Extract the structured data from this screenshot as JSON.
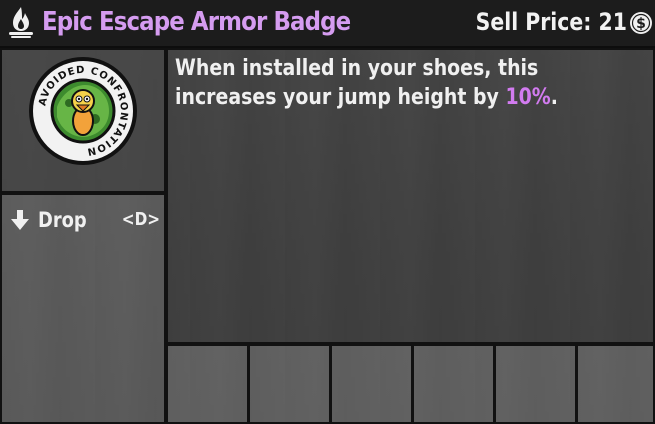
{
  "header": {
    "title": "Epic Escape Armor Badge",
    "sell_label": "Sell Price:",
    "sell_value": "21",
    "flame_icon": "campfire-icon",
    "coin_icon": "dukes-coin-icon",
    "title_color": "#d59cf0"
  },
  "item": {
    "icon": "avoided-confrontation-badge",
    "badge_text": "AVOIDED CONFRONTATION"
  },
  "description": {
    "text_before": "When installed in your shoes, this increases your jump height by ",
    "highlight": "10%",
    "text_after": ".",
    "highlight_color": "#d27bf0"
  },
  "actions": [
    {
      "icon": "arrow-down-icon",
      "label": "Drop",
      "key": "<D>"
    }
  ],
  "slots": [
    {},
    {},
    {},
    {},
    {},
    {}
  ]
}
